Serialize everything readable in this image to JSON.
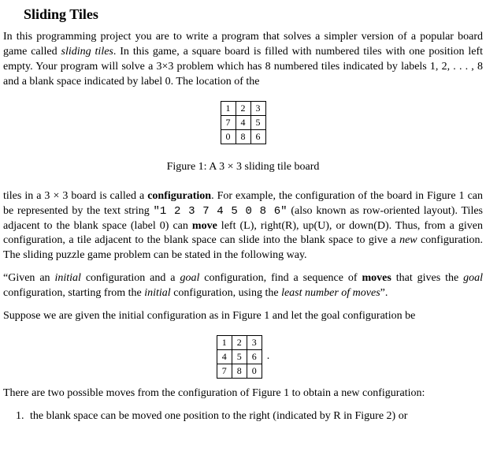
{
  "title": "Sliding Tiles",
  "p1_a": "In this programming project you are to write a program that solves a simpler version of a popular board game called ",
  "p1_b": "sliding tiles",
  "p1_c": ". In this game, a square board is filled with numbered tiles with one position left empty. Your program will solve a 3×3 problem which has 8 numbered tiles indicated by labels 1, 2, . . . , 8 and a blank space indicated by label 0. The location of the",
  "board1": {
    "rows": [
      [
        "1",
        "2",
        "3"
      ],
      [
        "7",
        "4",
        "5"
      ],
      [
        "0",
        "8",
        "6"
      ]
    ]
  },
  "caption1": "Figure 1: A 3 × 3 sliding tile board",
  "p2_a": "tiles in a 3 × 3 board is called a ",
  "p2_b": "configuration",
  "p2_c": ". For example, the configuration of the board in Figure 1 can be represented by the text string ",
  "p2_code": "\"1 2 3 7 4 5 0 8 6\"",
  "p2_d": " (also known as row-oriented layout). Tiles adjacent to the blank space (label 0) can ",
  "p2_e": "move",
  "p2_f": " left (L), right(R), up(U), or down(D). Thus, from a given configuration, a tile adjacent to the blank space can slide into the blank space to give a ",
  "p2_g": "new",
  "p2_h": " configuration. The sliding puzzle game problem can be stated in the following way.",
  "q_a": "“Given an ",
  "q_b": "initial",
  "q_c": " configuration and a ",
  "q_d": "goal",
  "q_e": " configuration, find a sequence of ",
  "q_f": "moves",
  "q_g": " that gives the ",
  "q_h": "goal",
  "q_i": " configuration, starting from the ",
  "q_j": "initial",
  "q_k": " configuration, using the ",
  "q_l": "least number of moves",
  "q_m": "”.",
  "p3": "Suppose we are given the initial configuration as in Figure 1 and let the goal configuration be",
  "board2": {
    "rows": [
      [
        "1",
        "2",
        "3"
      ],
      [
        "4",
        "5",
        "6"
      ],
      [
        "7",
        "8",
        "0"
      ]
    ],
    "side": "."
  },
  "p4": "There are two possible moves from the configuration of Figure 1 to obtain a new configuration:",
  "li1": "the blank space can be moved one position to the right (indicated by R in Figure 2) or"
}
